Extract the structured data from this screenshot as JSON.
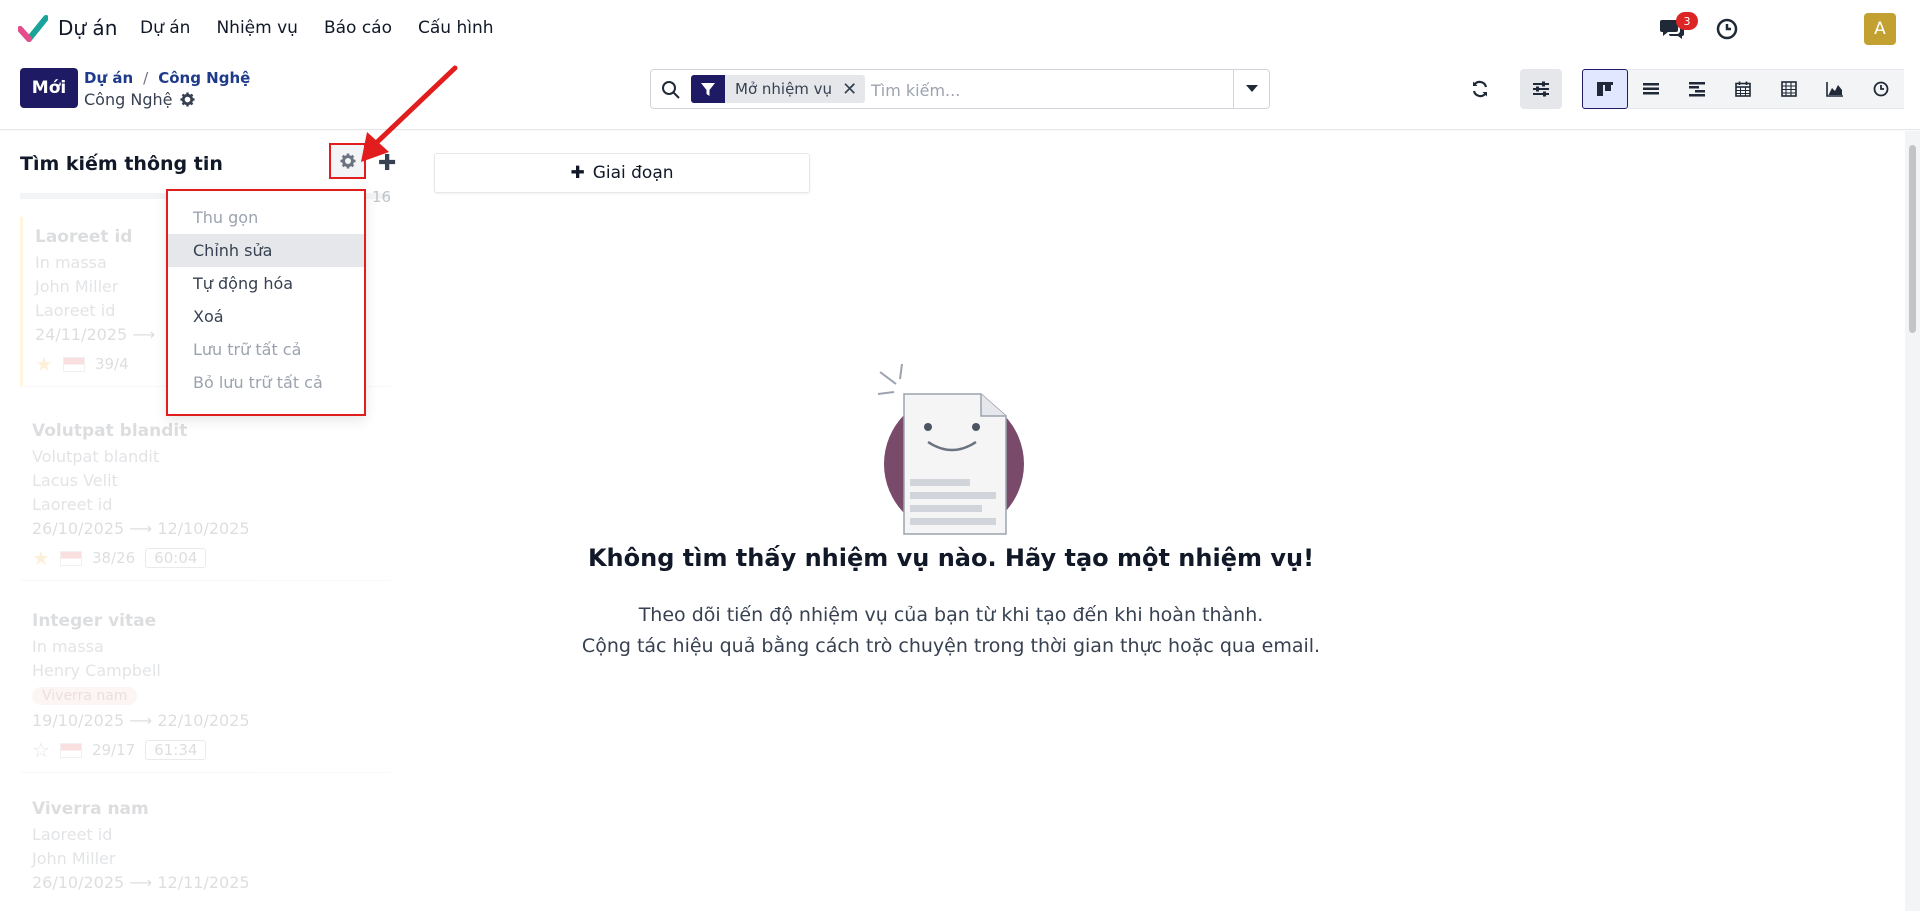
{
  "navbar": {
    "app_name": "Dự án",
    "menu": [
      "Dự án",
      "Nhiệm vụ",
      "Báo cáo",
      "Cấu hình"
    ],
    "chat_badge": "3",
    "avatar_letter": "A"
  },
  "control": {
    "new_button": "Mới",
    "breadcrumb": [
      "Dự án",
      "Công Nghệ"
    ],
    "breadcrumb_sep": "/",
    "subtitle": "Công Nghệ",
    "search_facet": "Mở nhiệm vụ",
    "search_facet_remove": "✕",
    "search_placeholder": "Tìm kiếm..."
  },
  "column": {
    "title": "Tìm kiếm thông tin",
    "count": "16",
    "plus": "✚"
  },
  "dropdown": {
    "items": [
      "Thu gọn",
      "Chỉnh sửa",
      "Tự động hóa",
      "Xoá",
      "Lưu trữ tất cả",
      "Bỏ lưu trữ tất cả"
    ]
  },
  "cards": [
    {
      "name": "Laoreet id",
      "project": "In massa",
      "user": "John Miller",
      "sub": "Laoreet id",
      "dates": "24/11/2025 ⟶",
      "check": "39/4",
      "timer": ""
    },
    {
      "name": "Volutpat blandit",
      "project": "Volutpat blandit",
      "user": "Lacus Velit",
      "sub": "Laoreet id",
      "dates": "26/10/2025 ⟶ 12/10/2025",
      "check": "38/26",
      "timer": "60:04"
    },
    {
      "name": "Integer vitae",
      "project": "In massa",
      "user": "Henry Campbell",
      "tag": "Viverra nam",
      "dates": "19/10/2025 ⟶ 22/10/2025",
      "check": "29/17",
      "timer": "61:34"
    },
    {
      "name": "Viverra nam",
      "project": "Laoreet id",
      "user": "John Miller",
      "dates": "26/10/2025 ⟶ 12/11/2025"
    }
  ],
  "stage_button": "Giai đoạn",
  "stage_plus": "✚",
  "empty": {
    "title": "Không tìm thấy nhiệm vụ nào. Hãy tạo một nhiệm vụ!",
    "line1": "Theo dõi tiến độ nhiệm vụ của bạn từ khi tạo đến khi hoàn thành.",
    "line2": "Cộng tác hiệu quả bằng cách trò chuyện trong thời gian thực hoặc qua email."
  },
  "colors": {
    "brand": "#1e1b64",
    "highlight": "#e11d1d",
    "badge": "#dc2626",
    "avatar": "#c2a032"
  }
}
